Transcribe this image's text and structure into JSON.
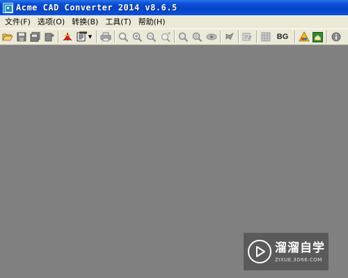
{
  "window": {
    "title": "Acme CAD Converter 2014 v8.6.5"
  },
  "menu": [
    {
      "label": "文件(F)"
    },
    {
      "label": "选项(O)"
    },
    {
      "label": "转换(B)"
    },
    {
      "label": "工具(T)"
    },
    {
      "label": "帮助(H)"
    }
  ],
  "toolbar": {
    "bg_label": "BG",
    "buttons": [
      "open-icon",
      "save-icon",
      "save-all-icon",
      "export-icon",
      "pdf-icon",
      "batch-icon",
      "print-icon",
      "zoom-out-icon",
      "zoom-in-icon",
      "zoom-window-icon",
      "zoom-extents-icon",
      "find-icon",
      "pan-icon",
      "view-icon",
      "layers-icon",
      "properties-icon",
      "grid-icon",
      "background-icon",
      "measure-icon",
      "home-icon",
      "info-icon"
    ]
  },
  "watermark": {
    "text": "溜溜自学",
    "url": "ZIXUE.3D66.COM"
  },
  "colors": {
    "titlebar": "#0a52dc",
    "workspace": "#808080",
    "chrome": "#ece9d8"
  }
}
